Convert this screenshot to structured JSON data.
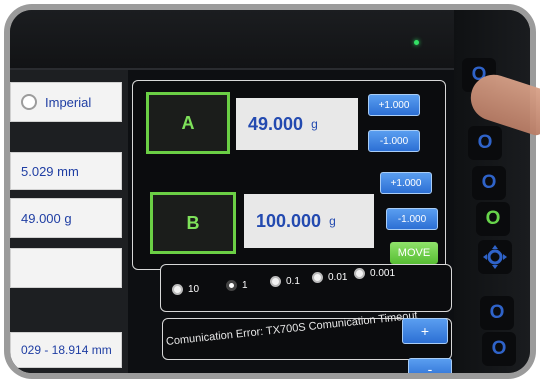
{
  "left_panel": {
    "unit_option": "Imperial",
    "field_1": "5.029 mm",
    "field_2": "49.000 g",
    "field_3": "",
    "field_4": "029 - 18.914 mm"
  },
  "channel_a": {
    "label": "A",
    "value": "49.000",
    "unit": "g",
    "plus_label": "+1.000",
    "minus_label": "-1.000"
  },
  "channel_b": {
    "label": "B",
    "value": "100.000",
    "unit": "g",
    "plus_label": "+1.000",
    "minus_label": "-1.000"
  },
  "move_label": "MOVE",
  "step_options": [
    {
      "label": "10",
      "selected": false
    },
    {
      "label": "1",
      "selected": true
    },
    {
      "label": "0.1",
      "selected": false
    },
    {
      "label": "0.01",
      "selected": false
    },
    {
      "label": "0.001",
      "selected": false
    }
  ],
  "error_message": "Comunication Error: TX700S Comunication Timeout",
  "lower_controls": {
    "plus_label": "+",
    "minus_label": "-"
  },
  "side_buttons": [
    "O",
    "O",
    "O",
    "O",
    "O",
    "O"
  ],
  "colors": {
    "accent_green": "#6bcf45",
    "accent_blue": "#2c6fd4"
  }
}
